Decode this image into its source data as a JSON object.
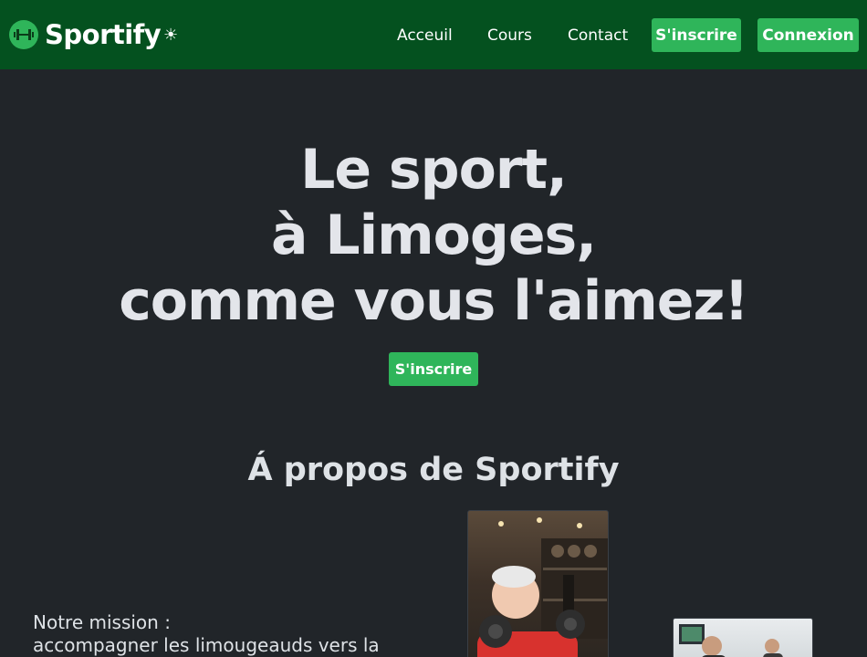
{
  "brand": {
    "name": "Sportify",
    "logo_icon": "dumbbell-icon"
  },
  "theme_toggle": {
    "glyph": "☀",
    "icon": "sun-icon"
  },
  "nav": {
    "links": [
      "Acceuil",
      "Cours",
      "Contact"
    ],
    "signup_label": "S'inscrire",
    "login_label": "Connexion"
  },
  "hero": {
    "lines": [
      "Le sport,",
      "à Limoges,",
      "comme vous l'aimez!"
    ],
    "cta_label": "S'inscrire"
  },
  "about": {
    "title": "Á propos de Sportify",
    "mission_lines": [
      "Notre mission :",
      "accompagner les limougeauds vers la"
    ]
  },
  "colors": {
    "navbar_bg": "#04511f",
    "accent_green": "#2fb55a",
    "page_bg": "#212529",
    "heading_text": "#e3e5ea"
  }
}
